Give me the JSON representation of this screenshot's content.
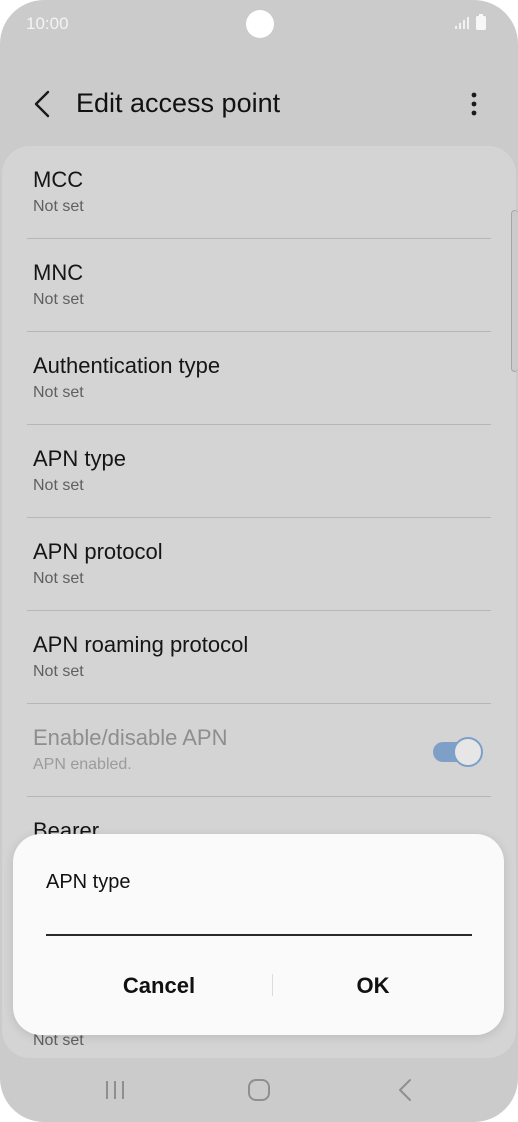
{
  "status_bar": {
    "time": "10:00"
  },
  "header": {
    "title": "Edit access point"
  },
  "settings": [
    {
      "title": "MCC",
      "value": "Not set"
    },
    {
      "title": "MNC",
      "value": "Not set"
    },
    {
      "title": "Authentication type",
      "value": "Not set"
    },
    {
      "title": "APN type",
      "value": "Not set"
    },
    {
      "title": "APN protocol",
      "value": "Not set"
    },
    {
      "title": "APN roaming protocol",
      "value": "Not set"
    },
    {
      "title": "Enable/disable APN",
      "value": "APN enabled.",
      "toggle_on": true,
      "disabled": true
    },
    {
      "title": "Bearer",
      "value": ""
    },
    {
      "title": "",
      "value": "Not set"
    }
  ],
  "dialog": {
    "title": "APN type",
    "input_value": "",
    "cancel_label": "Cancel",
    "ok_label": "OK"
  },
  "colors": {
    "toggle_accent": "#7d9fc8",
    "dim_background": "#cbcbcb"
  },
  "icons": {
    "back": "chevron-left-icon",
    "more": "more-vertical-icon",
    "nav_recents": "recents-icon",
    "nav_home": "home-icon",
    "nav_back": "back-icon"
  }
}
